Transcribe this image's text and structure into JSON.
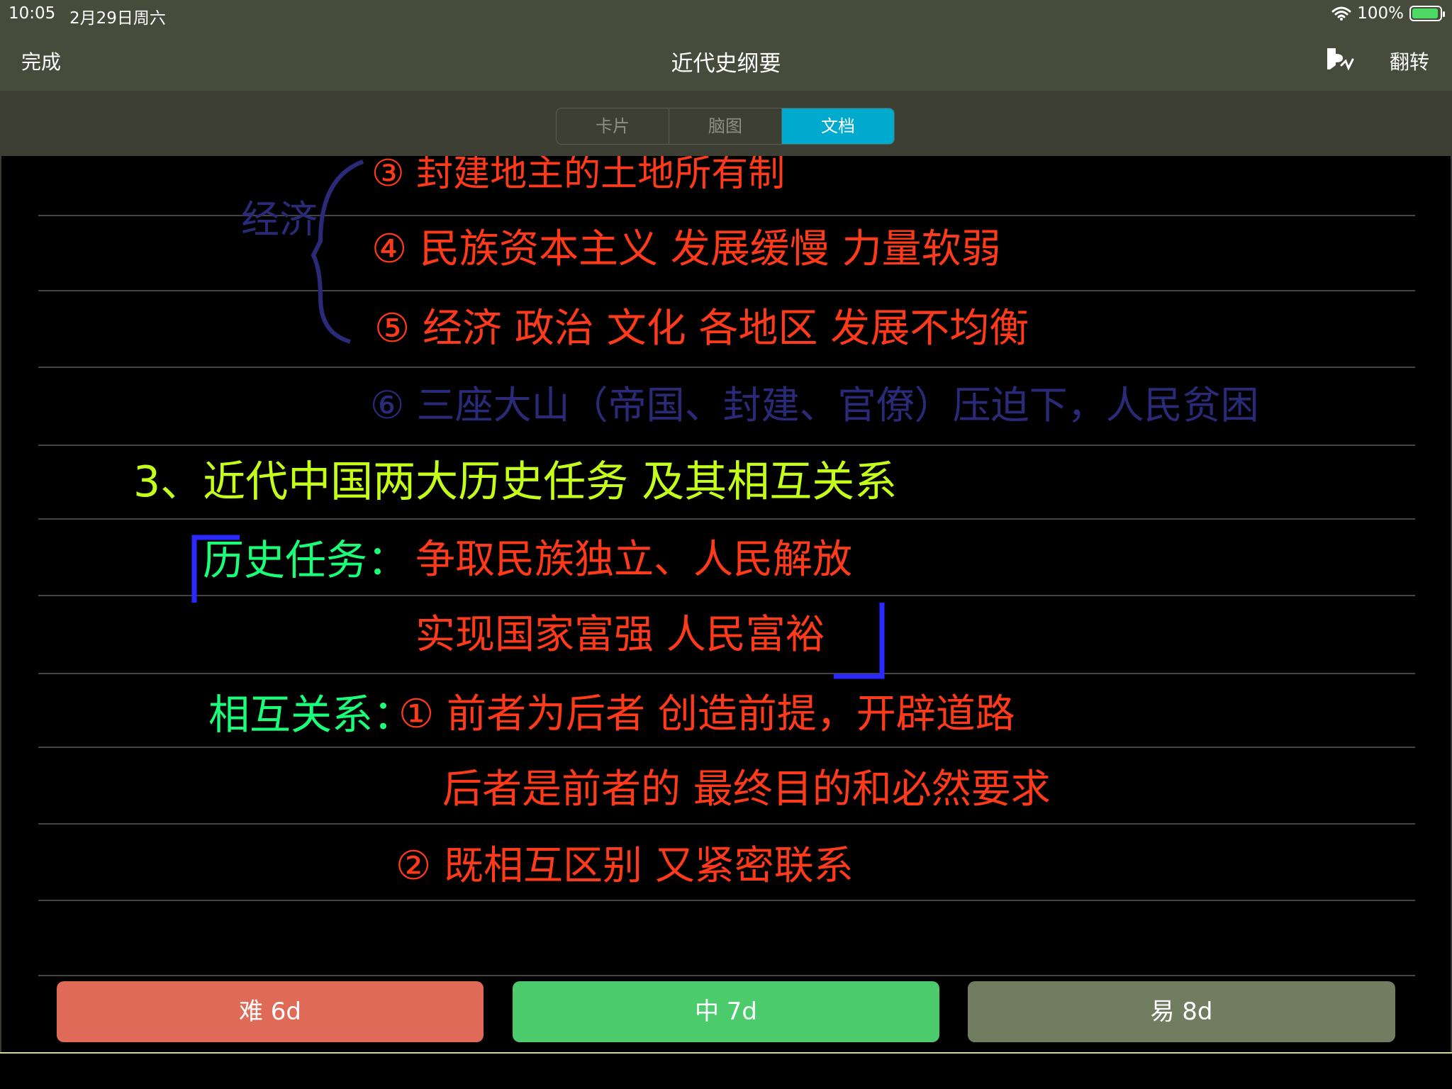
{
  "status_bar": {
    "time": "10:05",
    "date": "2月29日周六",
    "battery": "100%"
  },
  "nav": {
    "done_label": "完成",
    "title": "近代史纲要",
    "flip_label": "翻转",
    "pen_icon": "pen-speaker-icon"
  },
  "segments": [
    {
      "label": "卡片",
      "active": false
    },
    {
      "label": "脑图",
      "active": false
    },
    {
      "label": "文档",
      "active": true
    }
  ],
  "note_lines": {
    "brace_label": "经济",
    "line3": "③ 封建地主的土地所有制",
    "line4": "④ 民族资本主义 发展缓慢 力量软弱",
    "line5": "⑤ 经济 政治 文化 各地区 发展不均衡",
    "line6": "⑥ 三座大山（帝国、封建、官僚）压迫下，人民贫困",
    "heading": "3、近代中国两大历史任务 及其相互关系",
    "task_label": "历史任务：",
    "task_1": "争取民族独立、人民解放",
    "task_2": "实现国家富强 人民富裕",
    "relation_label": "相互关系：",
    "relation_1": "① 前者为后者 创造前提，开辟道路",
    "relation_2": "后者是前者的 最终目的和必然要求",
    "relation_3": "② 既相互区别 又紧密联系"
  },
  "ratings": {
    "hard": "难 6d",
    "medium": "中 7d",
    "easy": "易 8d"
  },
  "colors": {
    "navy_ink": "#2a2a78",
    "red_ink": "#ff3a1a",
    "lime_ink": "#c4ff1a",
    "green_ink": "#1aff7a",
    "blue_ink": "#2a2aff",
    "active_segment": "#00aacf"
  }
}
